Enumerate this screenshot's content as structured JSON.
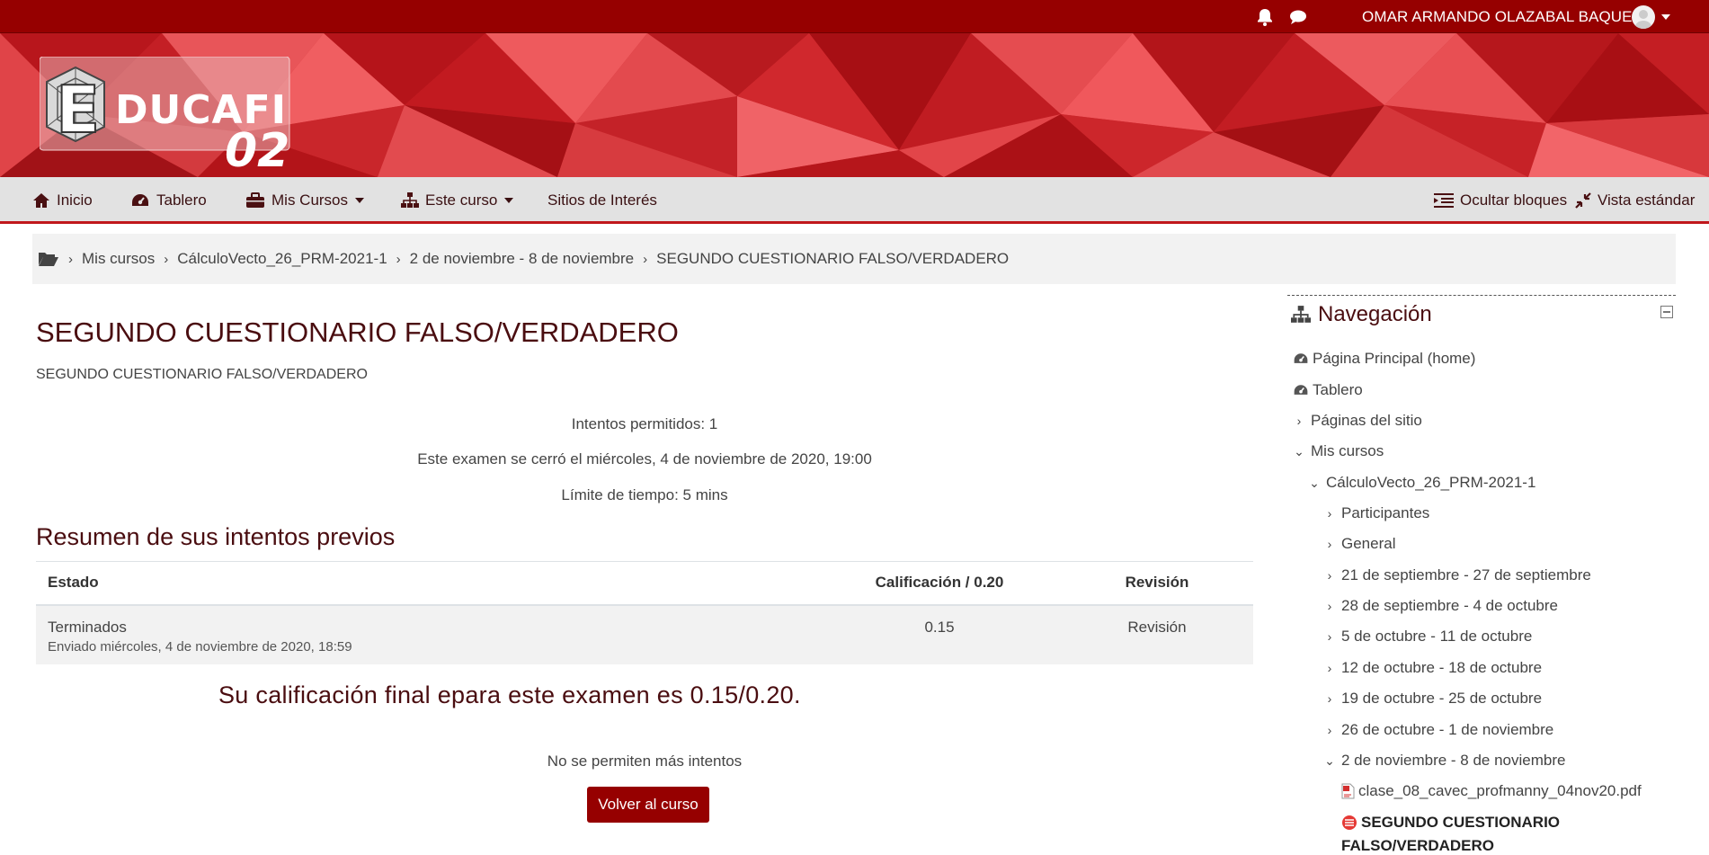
{
  "topbar": {
    "user_name": "OMAR ARMANDO OLAZABAL BAQUERO",
    "icons": [
      "bell-icon",
      "chat-icon",
      "avatar",
      "caret-down-icon"
    ]
  },
  "logo": {
    "text": "EDUCAFI",
    "number": "02"
  },
  "nav": {
    "home": "Inicio",
    "dashboard": "Tablero",
    "my_courses": "Mis Cursos",
    "this_course": "Este curso",
    "sites": "Sitios de Interés",
    "hide_blocks": "Ocultar bloques",
    "standard_view": "Vista estándar"
  },
  "breadcrumb": [
    "Mis cursos",
    "CálculoVecto_26_PRM-2021-1",
    "2 de noviembre - 8 de noviembre",
    "SEGUNDO CUESTIONARIO FALSO/VERDADERO"
  ],
  "main": {
    "title": "SEGUNDO CUESTIONARIO FALSO/VERDADERO",
    "subtitle": "SEGUNDO CUESTIONARIO FALSO/VERDADERO",
    "info_attempts": "Intentos permitidos: 1",
    "info_closed": "Este examen se cerró el miércoles, 4 de noviembre de 2020, 19:00",
    "info_time_limit": "Límite de tiempo: 5 mins",
    "summary_title": "Resumen de sus intentos previos",
    "table": {
      "headers": [
        "Estado",
        "Calificación / 0.20",
        "Revisión"
      ],
      "rows": [
        {
          "state": "Terminados",
          "submitted": "Enviado miércoles, 4 de noviembre de 2020, 18:59",
          "grade": "0.15",
          "review": "Revisión"
        }
      ]
    },
    "final_grade": "Su calificación final epara este examen es 0.15/0.20.",
    "no_more": "No se permiten más intentos",
    "back_button": "Volver al curso"
  },
  "navigation": {
    "title": "Navegación",
    "items": [
      "Página Principal (home)",
      "Tablero",
      "Páginas del sitio",
      "Mis cursos",
      "CálculoVecto_26_PRM-2021-1",
      "Participantes",
      "General",
      "21 de septiembre - 27 de septiembre",
      "28 de septiembre - 4 de octubre",
      "5 de octubre - 11 de octubre",
      "12 de octubre - 18 de octubre",
      "19 de octubre - 25 de octubre",
      "26 de octubre - 1 de noviembre",
      "2 de noviembre - 8 de noviembre",
      "clase_08_cavec_profmanny_04nov20.pdf",
      "SEGUNDO CUESTIONARIO",
      "FALSO/VERDADERO"
    ]
  },
  "colors": {
    "brand": "#960000",
    "accent": "#c0171c",
    "title": "#4a0d10"
  }
}
